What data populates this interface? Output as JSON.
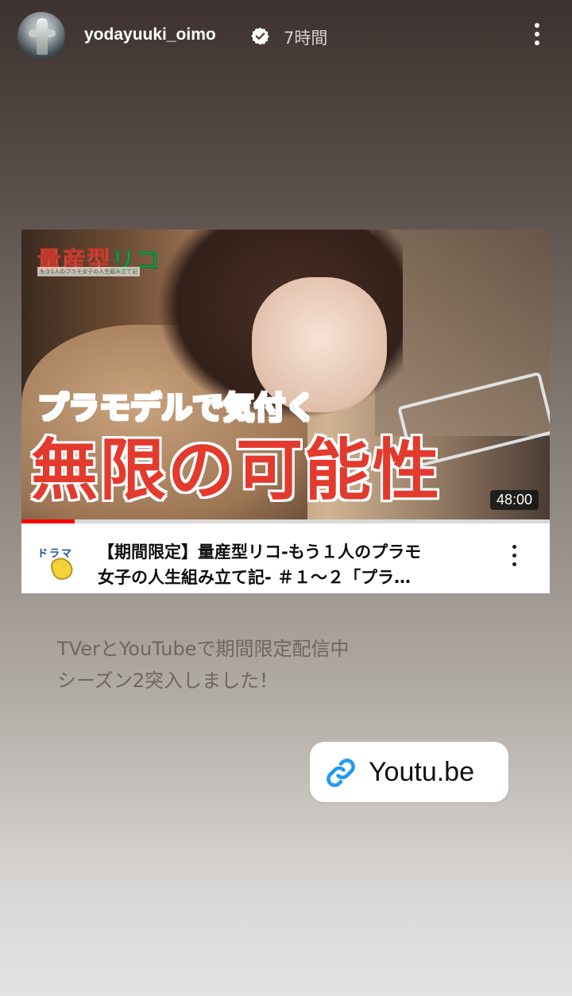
{
  "story": {
    "username": "yodayuuki_oimo",
    "time_ago": "7時間",
    "more_icon": "more-vertical-icon"
  },
  "video_card": {
    "thumbnail_logo": "量産型",
    "thumbnail_logo_accent": "リコ",
    "thumbnail_logo_sub": "もう1人のプラモ女子の人生組み立て記",
    "thumbnail_tagline": "プラモデルで気付く",
    "thumbnail_headline": "無限の可能性",
    "duration": "48:00",
    "progress_fraction": 0.1,
    "channel_icon_label": "ドラマ",
    "title_line1": "【期間限定】量産型リコ-もう１人のプラモ",
    "title_line2": "女子の人生組み立て記- ＃１～２「プラ…"
  },
  "caption": {
    "line1": "TVerとYouTubeで期間限定配信中",
    "line2": "シーズン2突入しました！"
  },
  "link_sticker": {
    "icon": "link-icon",
    "label": "Youtu.be",
    "accent": "#1d9bf0"
  }
}
